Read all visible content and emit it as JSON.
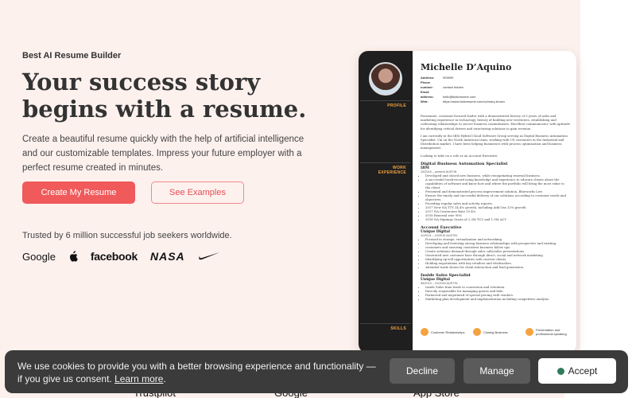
{
  "hero": {
    "eyebrow": "Best AI Resume Builder",
    "headline": "Your success story begins with a resume.",
    "subtitle": "Create a beautiful resume quickly with the help of artificial intelligence and our customizable templates. Impress your future employer with a perfect resume created in minutes.",
    "primary_button": "Create My Resume",
    "secondary_button": "See Examples",
    "trusted": "Trusted by 6 million successful job seekers worldwide.",
    "logos": [
      "Google",
      "Apple",
      "facebook",
      "NASA",
      "Nike"
    ]
  },
  "resume": {
    "name": "Michelle D’Aquino",
    "contact": [
      {
        "label": "Address:",
        "value": "909999"
      },
      {
        "label": "Phone number:",
        "value": "contact hidden"
      },
      {
        "label": "Email address:",
        "value": "hello@kickresume.com"
      },
      {
        "label": "Web:",
        "value": "https://www.kickresume.com/cv/mary-brown"
      }
    ],
    "sections": {
      "profile": "PROFILE",
      "work": "WORK EXPERIENCE",
      "skills": "SKILLS"
    },
    "profile_paragraphs": [
      "Passionate, customer-focused leader with a demonstrated history of 5 years of sales and marketing experience in technology, history of building new territories, establishing and cultivating relationships to secure business commitments. Excellent communicator, with aptitude for identifying critical drivers and structuring solutions to gain revenue.",
      "I am currently in the IBM Hybrid Cloud Software Group serving as Digital Business Automation Specialist. I'm on the North American team, working with US customers in the Industrial and Distribution market. I have been helping businesses with process optimization and business management.",
      "Looking to take on a role as an Account Executive."
    ],
    "jobs": [
      {
        "title": "Digital Business Automation Specialist",
        "company": "IBM",
        "meta": "10/2015 – present  AUSTIN",
        "bullets": [
          "Developed and closed new business, while renegotiating renewal business.",
          "A successful track-record using knowledge and experience to educate clients about the capabilities of software and know how and where the portfolio will bring the most value to the client.",
          "Presented and demonstrated process improvement solution, Blueworks Live.",
          "Ensure the timely and successful delivery of our solutions according to customer needs and objectives.",
          "Providing regular sales and activity reports.",
          "2017 New NA TTY 24.4% growth, including Add Ons 32% growth",
          "2017 NA Conversion Rate 10.4%",
          "2016 Renewal rate 90%",
          "2016 NA Signings Quota of 2.3M TCV and 1.9M ACV"
        ]
      },
      {
        "title": "Account Executive",
        "company": "Unique Digital",
        "meta": "11/2014 – 10/2015  AUSTIN",
        "bullets": [
          "Focused in storage, virtualization and networking",
          "Developing and fostering strong business relationships with prospective and existing customers and ensuring consistent business follow ups.",
          "Create solutions demand through sales calls/sales presentations.",
          "Generated new customer base through direct, social and network marketing",
          "Identifying up-sell opportunities with current clients.",
          "Holding negotiations with key retailers and wholesalers.",
          "Attended trade shows for client interaction and lead generation."
        ]
      },
      {
        "title": "Inside Sales Specialist",
        "company": "Unique Digital",
        "meta": "06/2013 – 01/2016  AUSTIN",
        "bullets": [
          "Inside Sales from leads to conversion and retention.",
          "Directly responsible for managing quotes and bids.",
          "Partnered and negotiated of special pricing with vendors.",
          "Marketing plan development and implementation including competitive analysis."
        ]
      }
    ],
    "skills": [
      "Customer Relationships",
      "Closing Business",
      "Presentation and professional speaking"
    ]
  },
  "cookie": {
    "text": "We use cookies to provide you with a better browsing experience and functionality — if you give us consent.",
    "link": "Learn more",
    "period": ".",
    "decline": "Decline",
    "manage": "Manage",
    "accept": "Accept"
  },
  "underlay": [
    "Trustpilot",
    "Google",
    "App Store"
  ],
  "colors": {
    "accent": "#f05a5b",
    "background": "#fdf1ee",
    "resume_accent": "#f4a340",
    "banner": "#3b3b3b"
  }
}
